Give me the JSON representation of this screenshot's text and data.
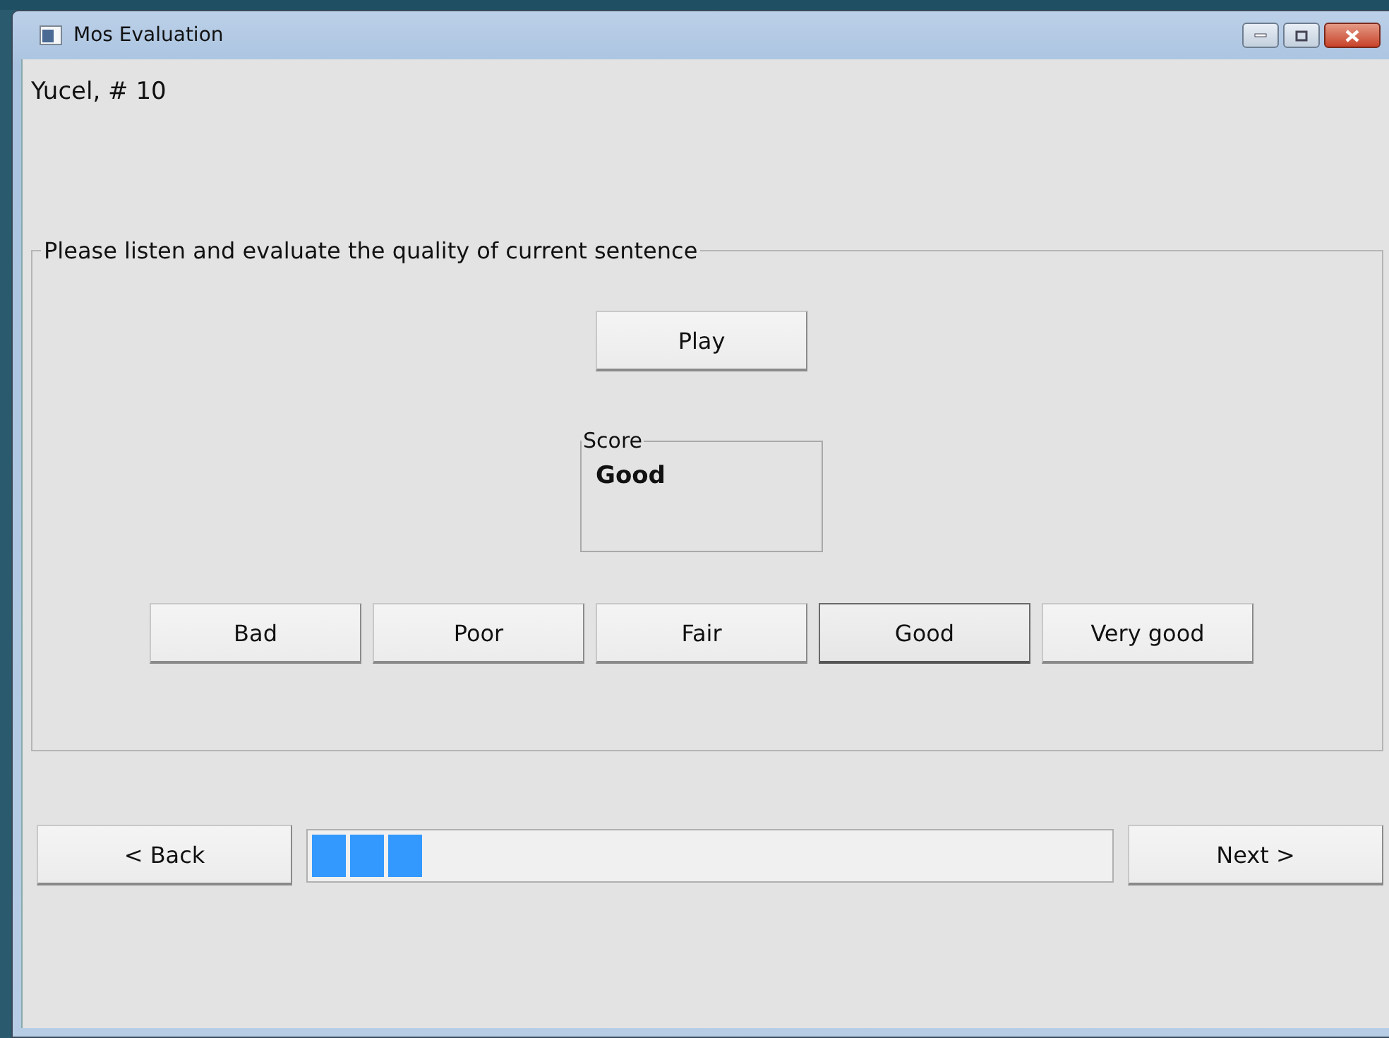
{
  "window": {
    "title": "Mos Evaluation"
  },
  "header": "Yucel, # 10",
  "evaluation_group": {
    "title": "Please listen and evaluate the quality of current sentence",
    "play_button": "Play",
    "score": {
      "title": "Score",
      "value": "Good"
    },
    "rating_buttons": [
      {
        "label": "Bad",
        "selected": false
      },
      {
        "label": "Poor",
        "selected": false
      },
      {
        "label": "Fair",
        "selected": false
      },
      {
        "label": "Good",
        "selected": true
      },
      {
        "label": "Very good",
        "selected": false
      }
    ]
  },
  "back_button": "< Back",
  "progress": {
    "level": 0.14
  },
  "next_button": "Next >"
}
